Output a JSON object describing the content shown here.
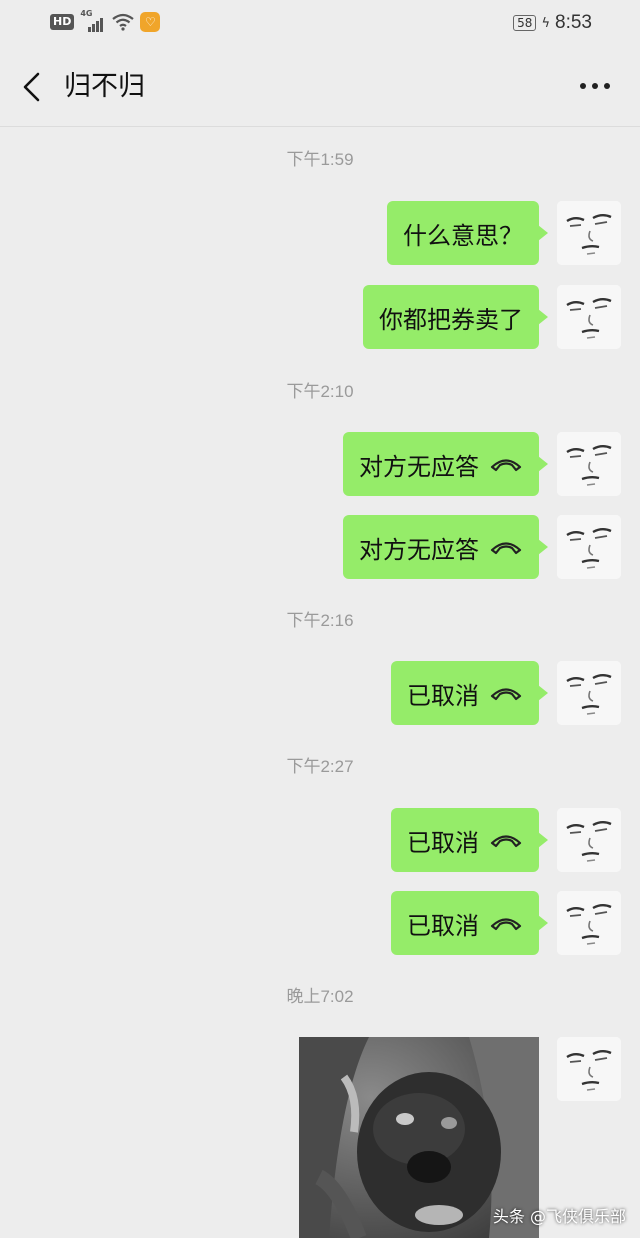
{
  "status_bar": {
    "hd_label": "HD",
    "network_label": "4G",
    "battery": "58",
    "time": "8:53"
  },
  "header": {
    "title": "归不归"
  },
  "timestamps": [
    "下午1:59",
    "下午2:10",
    "下午2:16",
    "下午2:27",
    "晚上7:02"
  ],
  "messages": [
    {
      "text": "什么意思？",
      "type": "text"
    },
    {
      "text": "你都把券卖了",
      "type": "text"
    },
    {
      "text": "对方无应答",
      "type": "call"
    },
    {
      "text": "对方无应答",
      "type": "call"
    },
    {
      "text": "已取消",
      "type": "call"
    },
    {
      "text": "已取消",
      "type": "call"
    },
    {
      "text": "已取消",
      "type": "call"
    },
    {
      "type": "image",
      "icon": "dog-photo"
    }
  ],
  "watermark": {
    "text": "头条 @飞侠俱乐部"
  },
  "colors": {
    "bubble": "#95ec69",
    "background": "#ededed"
  }
}
